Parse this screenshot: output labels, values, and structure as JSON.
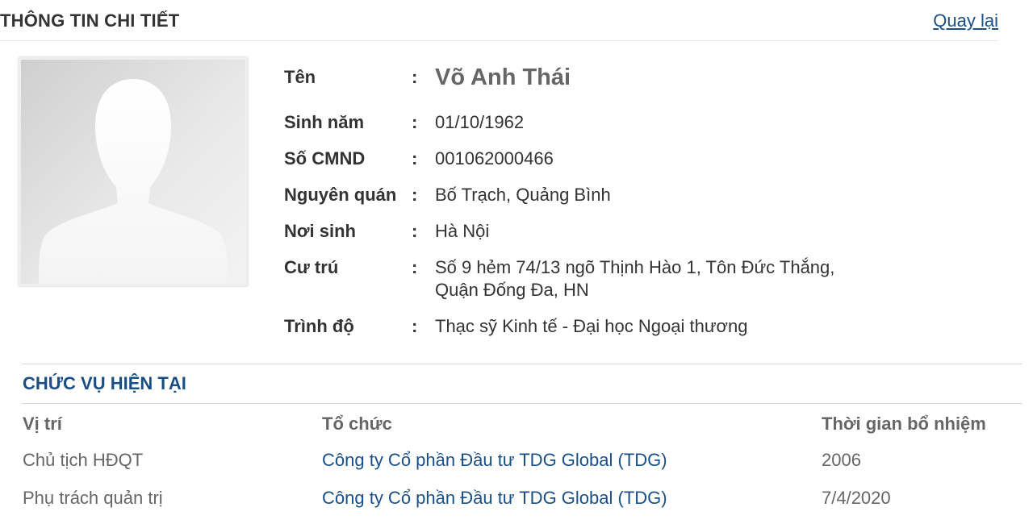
{
  "header": {
    "title": "THÔNG TIN CHI TIẾT",
    "back_link": "Quay lại"
  },
  "profile": {
    "avatar_icon": "person-silhouette-icon",
    "fields": {
      "name": {
        "label": "Tên",
        "value": "Võ Anh Thái"
      },
      "birth": {
        "label": "Sinh năm",
        "value": "01/10/1962"
      },
      "id_number": {
        "label": "Số CMND",
        "value": "001062000466"
      },
      "hometown": {
        "label": "Nguyên quán",
        "value": "Bố Trạch, Quảng Bình"
      },
      "birthplace": {
        "label": "Nơi sinh",
        "value": "Hà Nội"
      },
      "residence": {
        "label": "Cư trú",
        "value_line1": "Số 9 hẻm 74/13 ngõ Thịnh Hào 1, Tôn Đức Thắng,",
        "value_line2": "Quận Đống Đa, HN"
      },
      "education": {
        "label": "Trình độ",
        "value": "Thạc sỹ Kinh tế - Đại học Ngoại thương"
      }
    },
    "colon": ":"
  },
  "positions": {
    "title": "CHỨC VỤ HIỆN TẠI",
    "headers": {
      "role": "Vị trí",
      "organization": "Tổ chức",
      "appointed": "Thời gian bổ nhiệm"
    },
    "rows": [
      {
        "role": "Chủ tịch HĐQT",
        "organization": "Công ty Cổ phần Đầu tư TDG Global (TDG)",
        "appointed": "2006"
      },
      {
        "role": "Phụ trách quản trị",
        "organization": "Công ty Cổ phần Đầu tư TDG Global (TDG)",
        "appointed": "7/4/2020"
      }
    ]
  },
  "colors": {
    "link": "#1a4f86",
    "text": "#333333",
    "muted": "#666666"
  }
}
